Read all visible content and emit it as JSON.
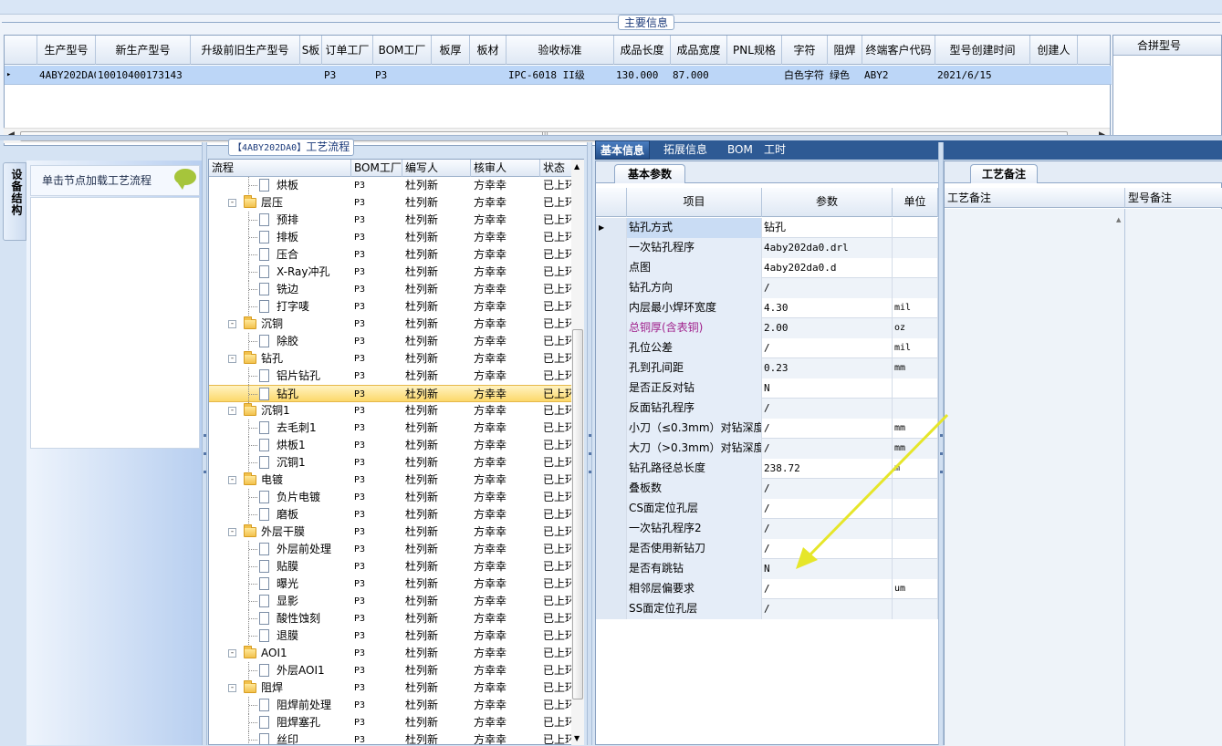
{
  "main_info": {
    "legend": "主要信息",
    "columns": [
      "生产型号",
      "新生产型号",
      "升级前旧生产型号",
      "S板",
      "订单工厂",
      "BOM工厂",
      "板厚",
      "板材",
      "验收标准",
      "成品长度",
      "成品宽度",
      "PNL规格",
      "字符",
      "阻焊",
      "终端客户代码",
      "型号创建时间",
      "创建人"
    ],
    "row": {
      "生产型号": "4ABY202DA0",
      "新生产型号": "10010400173143",
      "订单工厂": "P3",
      "BOM工厂": "P3",
      "验收标准": "IPC-6018 II级",
      "成品长度": "130.000",
      "成品宽度": "87.000",
      "字符": "白色字符",
      "阻焊": "绿色",
      "终端客户代码": "ABY2",
      "型号创建时间": "2021/6/15"
    },
    "merge_header": "合拼型号"
  },
  "left_panel": {
    "tab_label": "设备结构",
    "title": "单击节点加载工艺流程"
  },
  "process": {
    "legend_code": "【4ABY202DA0】",
    "legend_text": "工艺流程",
    "columns": [
      "流程",
      "BOM工厂",
      "编写人",
      "核审人",
      "状态"
    ],
    "rows": [
      {
        "name": "烘板",
        "lvl": 2,
        "f": "P3",
        "w": "杜列新",
        "r": "方幸幸",
        "s": "已上环"
      },
      {
        "name": "层压",
        "lvl": 1,
        "f": "P3",
        "w": "杜列新",
        "r": "方幸幸",
        "s": "已上环"
      },
      {
        "name": "预排",
        "lvl": 2,
        "f": "P3",
        "w": "杜列新",
        "r": "方幸幸",
        "s": "已上环"
      },
      {
        "name": "排板",
        "lvl": 2,
        "f": "P3",
        "w": "杜列新",
        "r": "方幸幸",
        "s": "已上环"
      },
      {
        "name": "压合",
        "lvl": 2,
        "f": "P3",
        "w": "杜列新",
        "r": "方幸幸",
        "s": "已上环"
      },
      {
        "name": "X-Ray冲孔",
        "lvl": 2,
        "f": "P3",
        "w": "杜列新",
        "r": "方幸幸",
        "s": "已上环"
      },
      {
        "name": "铣边",
        "lvl": 2,
        "f": "P3",
        "w": "杜列新",
        "r": "方幸幸",
        "s": "已上环"
      },
      {
        "name": "打字唛",
        "lvl": 2,
        "f": "P3",
        "w": "杜列新",
        "r": "方幸幸",
        "s": "已上环"
      },
      {
        "name": "沉铜",
        "lvl": 1,
        "f": "P3",
        "w": "杜列新",
        "r": "方幸幸",
        "s": "已上环"
      },
      {
        "name": "除胶",
        "lvl": 2,
        "f": "P3",
        "w": "杜列新",
        "r": "方幸幸",
        "s": "已上环"
      },
      {
        "name": "钻孔",
        "lvl": 1,
        "f": "P3",
        "w": "杜列新",
        "r": "方幸幸",
        "s": "已上环"
      },
      {
        "name": "铝片钻孔",
        "lvl": 2,
        "f": "P3",
        "w": "杜列新",
        "r": "方幸幸",
        "s": "已上环"
      },
      {
        "name": "钻孔",
        "lvl": 2,
        "f": "P3",
        "w": "杜列新",
        "r": "方幸幸",
        "s": "已上环",
        "sel": true
      },
      {
        "name": "沉铜1",
        "lvl": 1,
        "f": "P3",
        "w": "杜列新",
        "r": "方幸幸",
        "s": "已上环"
      },
      {
        "name": "去毛刺1",
        "lvl": 2,
        "f": "P3",
        "w": "杜列新",
        "r": "方幸幸",
        "s": "已上环"
      },
      {
        "name": "烘板1",
        "lvl": 2,
        "f": "P3",
        "w": "杜列新",
        "r": "方幸幸",
        "s": "已上环"
      },
      {
        "name": "沉铜1",
        "lvl": 2,
        "f": "P3",
        "w": "杜列新",
        "r": "方幸幸",
        "s": "已上环"
      },
      {
        "name": "电镀",
        "lvl": 1,
        "f": "P3",
        "w": "杜列新",
        "r": "方幸幸",
        "s": "已上环"
      },
      {
        "name": "负片电镀",
        "lvl": 2,
        "f": "P3",
        "w": "杜列新",
        "r": "方幸幸",
        "s": "已上环"
      },
      {
        "name": "磨板",
        "lvl": 2,
        "f": "P3",
        "w": "杜列新",
        "r": "方幸幸",
        "s": "已上环"
      },
      {
        "name": "外层干膜",
        "lvl": 1,
        "f": "P3",
        "w": "杜列新",
        "r": "方幸幸",
        "s": "已上环"
      },
      {
        "name": "外层前处理",
        "lvl": 2,
        "f": "P3",
        "w": "杜列新",
        "r": "方幸幸",
        "s": "已上环"
      },
      {
        "name": "贴膜",
        "lvl": 2,
        "f": "P3",
        "w": "杜列新",
        "r": "方幸幸",
        "s": "已上环"
      },
      {
        "name": "曝光",
        "lvl": 2,
        "f": "P3",
        "w": "杜列新",
        "r": "方幸幸",
        "s": "已上环"
      },
      {
        "name": "显影",
        "lvl": 2,
        "f": "P3",
        "w": "杜列新",
        "r": "方幸幸",
        "s": "已上环"
      },
      {
        "name": "酸性蚀刻",
        "lvl": 2,
        "f": "P3",
        "w": "杜列新",
        "r": "方幸幸",
        "s": "已上环"
      },
      {
        "name": "退膜",
        "lvl": 2,
        "f": "P3",
        "w": "杜列新",
        "r": "方幸幸",
        "s": "已上环"
      },
      {
        "name": "AOI1",
        "lvl": 1,
        "f": "P3",
        "w": "杜列新",
        "r": "方幸幸",
        "s": "已上环"
      },
      {
        "name": "外层AOI1",
        "lvl": 2,
        "f": "P3",
        "w": "杜列新",
        "r": "方幸幸",
        "s": "已上环"
      },
      {
        "name": "阻焊",
        "lvl": 1,
        "f": "P3",
        "w": "杜列新",
        "r": "方幸幸",
        "s": "已上环"
      },
      {
        "name": "阻焊前处理",
        "lvl": 2,
        "f": "P3",
        "w": "杜列新",
        "r": "方幸幸",
        "s": "已上环"
      },
      {
        "name": "阻焊塞孔",
        "lvl": 2,
        "f": "P3",
        "w": "杜列新",
        "r": "方幸幸",
        "s": "已上环"
      },
      {
        "name": "丝印",
        "lvl": 2,
        "f": "P3",
        "w": "杜列新",
        "r": "方幸幸",
        "s": "已上环"
      }
    ]
  },
  "tabs": [
    "基本信息",
    "拓展信息",
    "BOM",
    "工时"
  ],
  "basic": {
    "tab": "基本参数",
    "columns": [
      "项目",
      "参数",
      "单位"
    ],
    "rows": [
      {
        "k": "钻孔方式",
        "v": "钻孔",
        "u": ""
      },
      {
        "k": "一次钻孔程序",
        "v": "4aby202da0.drl",
        "u": ""
      },
      {
        "k": "点图",
        "v": "4aby202da0.d",
        "u": ""
      },
      {
        "k": "钻孔方向",
        "v": "/",
        "u": ""
      },
      {
        "k": "内层最小焊环宽度",
        "v": "4.30",
        "u": "mil"
      },
      {
        "k": "总铜厚(含表铜)",
        "v": "2.00",
        "u": "oz",
        "color": "#a0218c"
      },
      {
        "k": "孔位公差",
        "v": "/",
        "u": "mil"
      },
      {
        "k": "孔到孔间距",
        "v": "0.23",
        "u": "mm"
      },
      {
        "k": "是否正反对钻",
        "v": "N",
        "u": ""
      },
      {
        "k": "反面钻孔程序",
        "v": "/",
        "u": ""
      },
      {
        "k": "小刀（≤0.3mm）对钻深度",
        "v": "/",
        "u": "mm"
      },
      {
        "k": "大刀（>0.3mm）对钻深度",
        "v": "/",
        "u": "mm"
      },
      {
        "k": "钻孔路径总长度",
        "v": "238.72",
        "u": "m"
      },
      {
        "k": "叠板数",
        "v": "/",
        "u": ""
      },
      {
        "k": "CS面定位孔层",
        "v": "/",
        "u": ""
      },
      {
        "k": "一次钻孔程序2",
        "v": "/",
        "u": ""
      },
      {
        "k": "是否使用新钻刀",
        "v": "/",
        "u": ""
      },
      {
        "k": "是否有跳钻",
        "v": "N",
        "u": ""
      },
      {
        "k": "相邻层偏要求",
        "v": "/",
        "u": "um"
      },
      {
        "k": "SS面定位孔层",
        "v": "/",
        "u": ""
      }
    ]
  },
  "notes": {
    "tab": "工艺备注",
    "col1": "工艺备注",
    "col2": "型号备注"
  },
  "colors": {
    "accent": "#2e5a94",
    "selection": "#bcd6f7",
    "tree_selection": "#fcd86a",
    "arrow": "#e6e62a"
  }
}
